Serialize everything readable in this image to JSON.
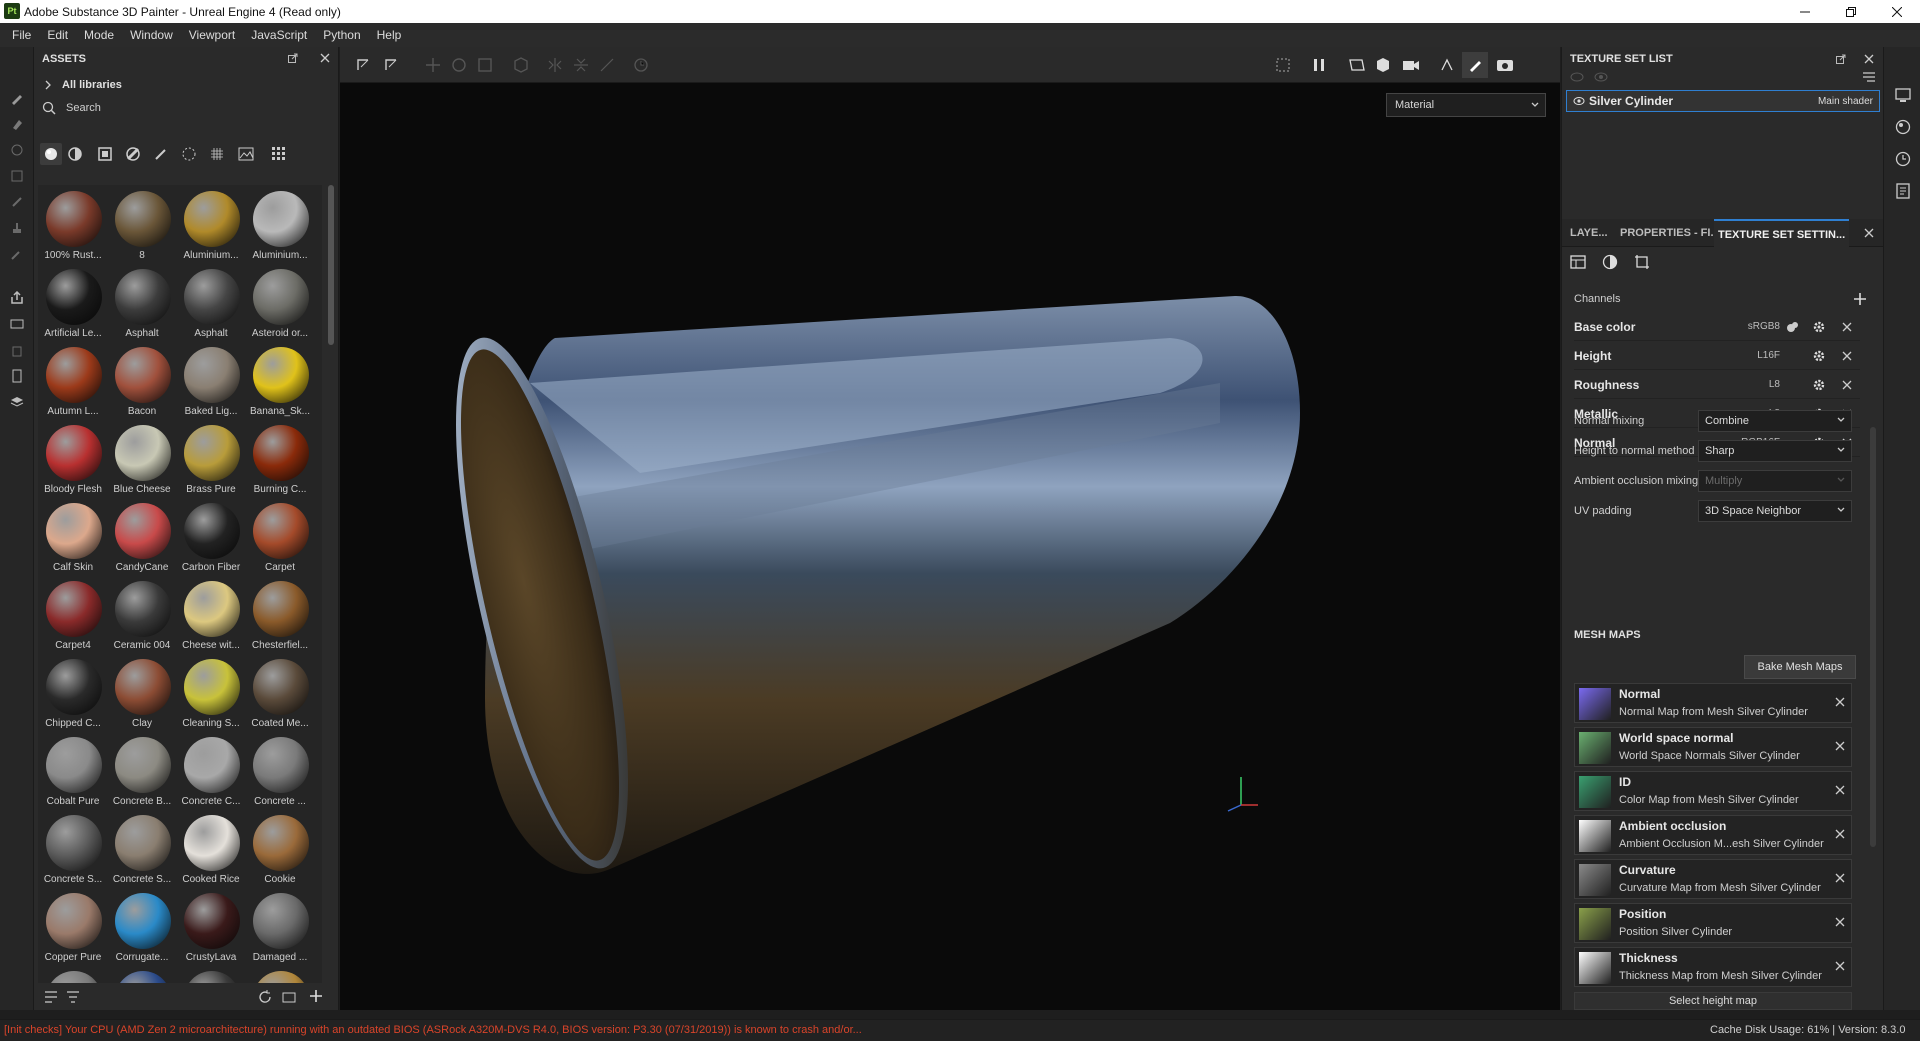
{
  "window": {
    "title": "Adobe Substance 3D Painter - Unreal Engine 4 (Read only)",
    "logo_text": "Pt"
  },
  "menu": [
    "File",
    "Edit",
    "Mode",
    "Window",
    "Viewport",
    "JavaScript",
    "Python",
    "Help"
  ],
  "assets": {
    "title": "ASSETS",
    "library": "All libraries",
    "search_placeholder": "Search",
    "items": [
      {
        "label": "100% Rust...",
        "color": "#7a3a2a"
      },
      {
        "label": "8",
        "color": "#6a5638"
      },
      {
        "label": "Aluminium...",
        "color": "#b08a2a"
      },
      {
        "label": "Aluminium...",
        "color": "#b9b9b9"
      },
      {
        "label": "Artificial Le...",
        "color": "#1a1a1a"
      },
      {
        "label": "Asphalt",
        "color": "#3c3c3c"
      },
      {
        "label": "Asphalt",
        "color": "#454545"
      },
      {
        "label": "Asteroid or...",
        "color": "#6c6c66"
      },
      {
        "label": "Autumn L...",
        "color": "#9c3a1a"
      },
      {
        "label": "Bacon",
        "color": "#a0503c"
      },
      {
        "label": "Baked Lig...",
        "color": "#8a7f72"
      },
      {
        "label": "Banana_Sk...",
        "color": "#e0c21a"
      },
      {
        "label": "Bloody Flesh",
        "color": "#b83030"
      },
      {
        "label": "Blue Cheese",
        "color": "#c8c8b4"
      },
      {
        "label": "Brass Pure",
        "color": "#b89c3a"
      },
      {
        "label": "Burning C...",
        "color": "#8a2a0a"
      },
      {
        "label": "Calf Skin",
        "color": "#dca88c"
      },
      {
        "label": "CandyCane",
        "color": "#c84a4a"
      },
      {
        "label": "Carbon Fiber",
        "color": "#222222"
      },
      {
        "label": "Carpet",
        "color": "#a44a2a"
      },
      {
        "label": "Carpet4",
        "color": "#8a2a2a"
      },
      {
        "label": "Ceramic 004",
        "color": "#3a3a3a"
      },
      {
        "label": "Cheese wit...",
        "color": "#dcc880"
      },
      {
        "label": "Chesterfiel...",
        "color": "#8a5a2a"
      },
      {
        "label": "Chipped C...",
        "color": "#2a2a2a"
      },
      {
        "label": "Clay",
        "color": "#8c4c34"
      },
      {
        "label": "Cleaning S...",
        "color": "#c8c23a"
      },
      {
        "label": "Coated Me...",
        "color": "#5a4a3a"
      },
      {
        "label": "Cobalt Pure",
        "color": "#8a8a8a"
      },
      {
        "label": "Concrete B...",
        "color": "#8c8a82"
      },
      {
        "label": "Concrete C...",
        "color": "#a8a8a8"
      },
      {
        "label": "Concrete ...",
        "color": "#7a7a7a"
      },
      {
        "label": "Concrete S...",
        "color": "#5c5c5c"
      },
      {
        "label": "Concrete S...",
        "color": "#8a7e70"
      },
      {
        "label": "Cooked Rice",
        "color": "#e4e0da"
      },
      {
        "label": "Cookie",
        "color": "#9a6a3a"
      },
      {
        "label": "Copper Pure",
        "color": "#9a7a6a"
      },
      {
        "label": "Corrugate...",
        "color": "#2a8ac8"
      },
      {
        "label": "CrustyLava",
        "color": "#3a1a1a"
      },
      {
        "label": "Damaged ...",
        "color": "#6a6a6a"
      },
      {
        "label": "",
        "color": "#7a7a7a"
      },
      {
        "label": "",
        "color": "#2a4a8a"
      },
      {
        "label": "",
        "color": "#3a3a3a"
      },
      {
        "label": "",
        "color": "#b0863a"
      }
    ]
  },
  "viewport": {
    "mode": "Material"
  },
  "texture_set_list": {
    "title": "TEXTURE SET LIST",
    "set_name": "Silver Cylinder",
    "shader": "Main shader"
  },
  "tabs": [
    "LAYE...",
    "PROPERTIES - FI...",
    "TEXTURE SET SETTIN..."
  ],
  "texture_set_settings": {
    "channels_title": "Channels",
    "channels": [
      {
        "name": "Base color",
        "format": "sRGB8"
      },
      {
        "name": "Height",
        "format": "L16F"
      },
      {
        "name": "Roughness",
        "format": "L8"
      },
      {
        "name": "Metallic",
        "format": "L8"
      },
      {
        "name": "Normal",
        "format": "RGB16F"
      }
    ],
    "normal_mixing": {
      "label": "Normal mixing",
      "value": "Combine"
    },
    "height_to_normal": {
      "label": "Height to normal method",
      "value": "Sharp"
    },
    "ao_mixing": {
      "label": "Ambient occlusion mixing",
      "value": "Multiply"
    },
    "uv_padding": {
      "label": "UV padding",
      "value": "3D Space Neighbor"
    },
    "mesh_maps_title": "MESH MAPS",
    "bake_button": "Bake Mesh Maps",
    "mesh_maps": [
      {
        "title": "Normal",
        "sub": "Normal Map from Mesh Silver Cylinder",
        "color": "#7a6af0"
      },
      {
        "title": "World space normal",
        "sub": "World Space Normals Silver Cylinder",
        "color": "#6ab070"
      },
      {
        "title": "ID",
        "sub": "Color Map from Mesh Silver Cylinder",
        "color": "#3aa070"
      },
      {
        "title": "Ambient occlusion",
        "sub": "Ambient Occlusion M...esh Silver Cylinder",
        "color": "#ffffff"
      },
      {
        "title": "Curvature",
        "sub": "Curvature Map from Mesh Silver Cylinder",
        "color": "#8a8a8a"
      },
      {
        "title": "Position",
        "sub": "Position Silver Cylinder",
        "color": "#8aa04a"
      },
      {
        "title": "Thickness",
        "sub": "Thickness Map from Mesh Silver Cylinder",
        "color": "#ffffff"
      }
    ],
    "select_height_map": "Select height map"
  },
  "status": {
    "message": "[Init checks] Your CPU (AMD Zen 2 microarchitecture) running with an outdated BIOS (ASRock A320M-DVS R4.0, BIOS version: P3.30 (07/31/2019)) is known to crash and/or...",
    "cache": "Cache Disk Usage:   61% | Version: 8.3.0"
  }
}
